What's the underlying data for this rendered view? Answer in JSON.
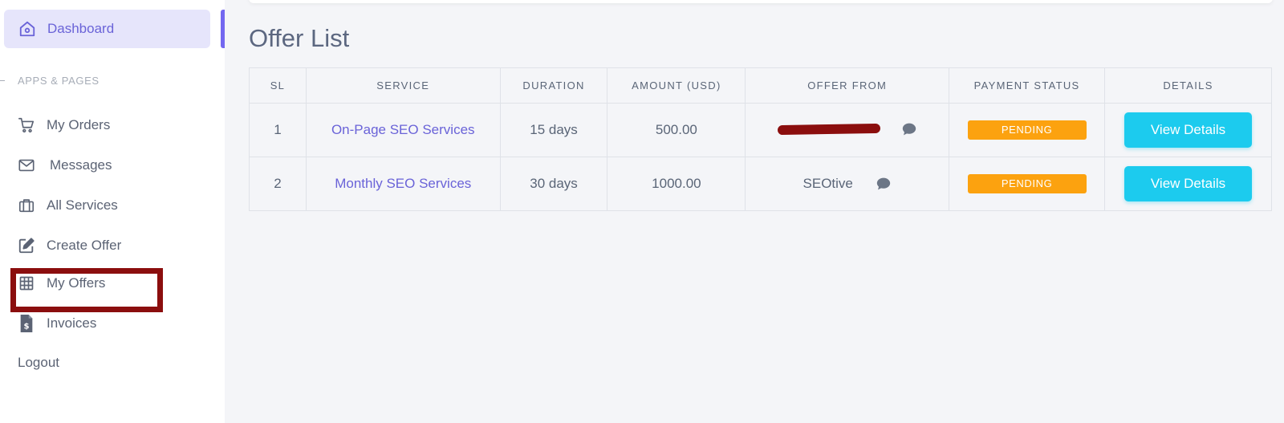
{
  "sidebar": {
    "dashboard_label": "Dashboard",
    "section_header": "APPS & PAGES",
    "items": [
      {
        "label": "My Orders",
        "icon": "cart-icon"
      },
      {
        "label": "Messages",
        "icon": "mail-icon"
      },
      {
        "label": "All Services",
        "icon": "briefcase-icon"
      },
      {
        "label": "Create Offer",
        "icon": "edit-icon"
      },
      {
        "label": "My Offers",
        "icon": "grid-icon"
      },
      {
        "label": "Invoices",
        "icon": "invoice-icon"
      }
    ],
    "logout_label": "Logout"
  },
  "main": {
    "title": "Offer List",
    "table": {
      "headers": [
        "SL",
        "SERVICE",
        "DURATION",
        "AMOUNT (USD)",
        "OFFER FROM",
        "PAYMENT STATUS",
        "DETAILS"
      ],
      "rows": [
        {
          "sl": "1",
          "service": "On-Page SEO Services",
          "duration": "15 days",
          "amount": "500.00",
          "offer_from": "",
          "payment_status": "PENDING",
          "details": "View Details"
        },
        {
          "sl": "2",
          "service": "Monthly SEO Services",
          "duration": "30 days",
          "amount": "1000.00",
          "offer_from": "SEOtive",
          "payment_status": "PENDING",
          "details": "View Details"
        }
      ]
    }
  },
  "colors": {
    "accent": "#7367f0",
    "badge_pending": "#fca20f",
    "button": "#1ccbee",
    "highlight": "#8b0e0e"
  }
}
